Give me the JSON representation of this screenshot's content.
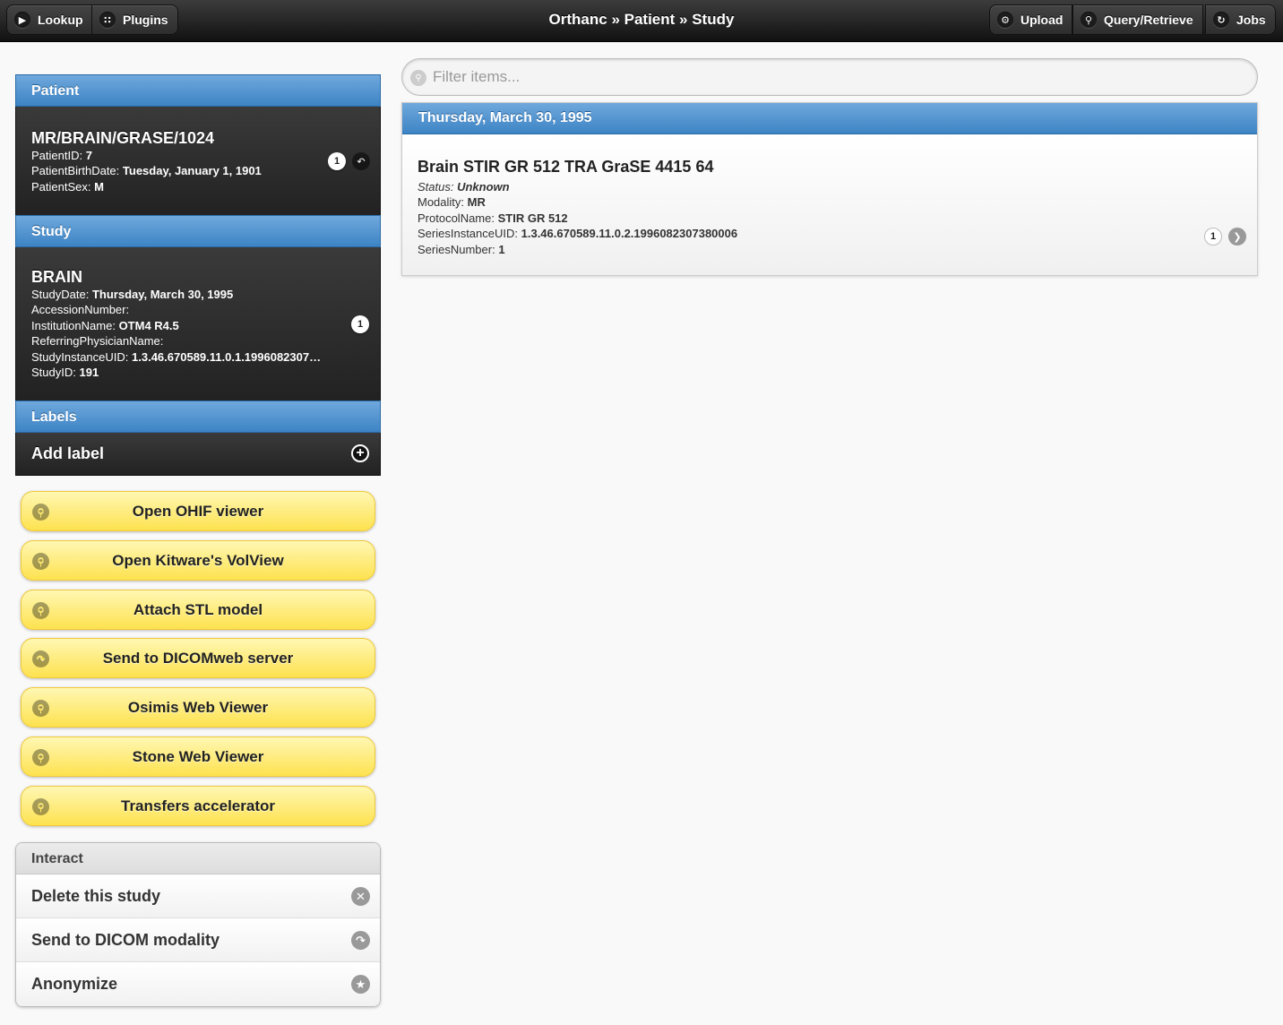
{
  "header": {
    "title": "Orthanc » Patient » Study",
    "left_buttons": [
      {
        "label": "Lookup",
        "icon": "chevron-right-icon"
      },
      {
        "label": "Plugins",
        "icon": "grid-icon"
      }
    ],
    "right_buttons": [
      {
        "label": "Upload",
        "icon": "gear-icon"
      },
      {
        "label": "Query/Retrieve",
        "icon": "search-icon"
      },
      {
        "label": "Jobs",
        "icon": "refresh-icon"
      }
    ]
  },
  "patient": {
    "section_label": "Patient",
    "name": "MR/BRAIN/GRASE/1024",
    "fields": [
      {
        "key": "PatientID:",
        "value": "7"
      },
      {
        "key": "PatientBirthDate:",
        "value": "Tuesday, January 1, 1901"
      },
      {
        "key": "PatientSex:",
        "value": "M"
      }
    ],
    "count": "1"
  },
  "study": {
    "section_label": "Study",
    "name": "BRAIN",
    "fields": [
      {
        "key": "StudyDate:",
        "value": "Thursday, March 30, 1995"
      },
      {
        "key": "AccessionNumber:",
        "value": ""
      },
      {
        "key": "InstitutionName:",
        "value": "OTM4 R4.5"
      },
      {
        "key": "ReferringPhysicianName:",
        "value": ""
      },
      {
        "key": "StudyInstanceUID:",
        "value": "1.3.46.670589.11.0.1.1996082307…"
      },
      {
        "key": "StudyID:",
        "value": "191"
      }
    ],
    "count": "1"
  },
  "labels": {
    "section_label": "Labels",
    "add_label": "Add label"
  },
  "actions": [
    {
      "label": "Open OHIF viewer",
      "icon": "search-icon"
    },
    {
      "label": "Open Kitware's VolView",
      "icon": "search-icon"
    },
    {
      "label": "Attach STL model",
      "icon": "search-icon"
    },
    {
      "label": "Send to DICOMweb server",
      "icon": "forward-icon"
    },
    {
      "label": "Osimis Web Viewer",
      "icon": "search-icon"
    },
    {
      "label": "Stone Web Viewer",
      "icon": "search-icon"
    },
    {
      "label": "Transfers accelerator",
      "icon": "search-icon"
    }
  ],
  "interact": {
    "header": "Interact",
    "items": [
      {
        "label": "Delete this study",
        "icon": "delete-icon"
      },
      {
        "label": "Send to DICOM modality",
        "icon": "forward-icon"
      },
      {
        "label": "Anonymize",
        "icon": "star-icon"
      }
    ]
  },
  "filter": {
    "placeholder": "Filter items..."
  },
  "series_list": {
    "date_header": "Thursday, March 30, 1995",
    "item": {
      "name": "Brain STIR GR 512 TRA GraSE 4415 64",
      "status_key": "Status:",
      "status_value": "Unknown",
      "fields": [
        {
          "key": "Modality:",
          "value": "MR"
        },
        {
          "key": "ProtocolName:",
          "value": "STIR GR 512"
        },
        {
          "key": "SeriesInstanceUID:",
          "value": "1.3.46.670589.11.0.2.1996082307380006"
        },
        {
          "key": "SeriesNumber:",
          "value": "1"
        }
      ],
      "count": "1"
    }
  },
  "colors": {
    "header_bg": "#1a1a1a",
    "divider_blue": "#3d84c5",
    "yellow_button": "#fde24f"
  }
}
